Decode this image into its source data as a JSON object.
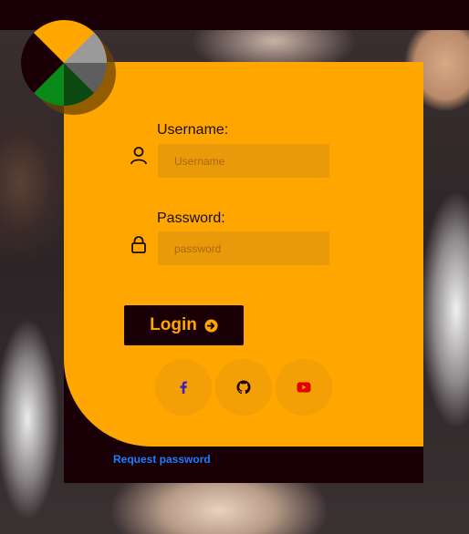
{
  "form": {
    "username_label": "Username:",
    "username_placeholder": "Username",
    "password_label": "Password:",
    "password_placeholder": "password",
    "login_label": "Login"
  },
  "social": [
    {
      "name": "facebook",
      "icon": "facebook-icon",
      "color": "#3b1fc8"
    },
    {
      "name": "github",
      "icon": "github-icon",
      "color": "#1a0006"
    },
    {
      "name": "youtube",
      "icon": "youtube-icon",
      "color": "#e00000"
    }
  ],
  "footer": {
    "request_password": "Request password"
  },
  "colors": {
    "accent": "#ffa600",
    "dark": "#180006",
    "input_bg": "#e89a0b",
    "link": "#1e7bff",
    "logo": [
      "#ffa600",
      "#9a9a9a",
      "#5a5a5a",
      "#0a5a0a",
      "#0a8a0a",
      "#1a0006"
    ]
  }
}
